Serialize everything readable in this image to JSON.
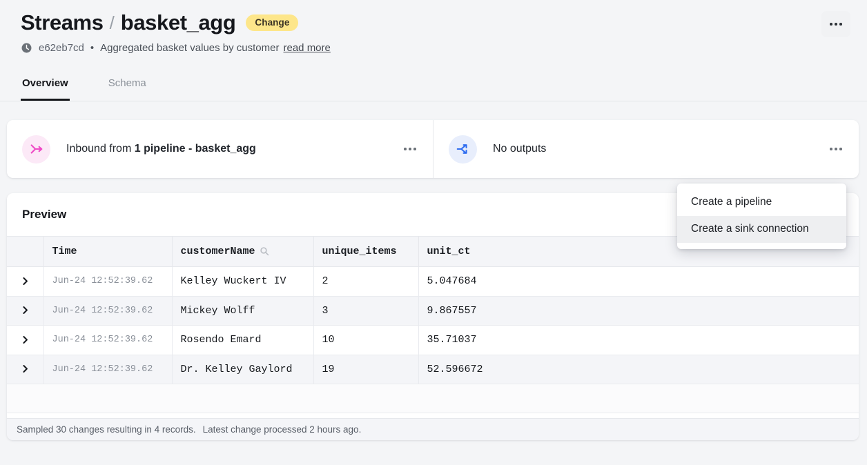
{
  "header": {
    "breadcrumb_parent": "Streams",
    "separator": "/",
    "breadcrumb_current": "basket_agg",
    "badge": "Change",
    "hash": "e62eb7cd",
    "bullet": "•",
    "description": "Aggregated basket values by customer",
    "read_more": "read more",
    "clock_icon": "clock-icon",
    "kebab_icon": "more-options-icon"
  },
  "tabs": [
    {
      "label": "Overview",
      "active": true
    },
    {
      "label": "Schema",
      "active": false
    }
  ],
  "cards": [
    {
      "icon": "merge-arrow-icon",
      "icon_color": "#ef4bc6",
      "icon_bg": "#fce9f7",
      "text_prefix": "Inbound from ",
      "text_strong": "1 pipeline - basket_agg",
      "kebab": "more-options-icon"
    },
    {
      "icon": "split-arrow-icon",
      "icon_color": "#2f6df0",
      "icon_bg": "#e8eefc",
      "text_prefix": "No outputs",
      "text_strong": "",
      "kebab": "more-options-icon"
    }
  ],
  "dropdown": {
    "items": [
      {
        "label": "Create a pipeline",
        "hovered": false
      },
      {
        "label": "Create a sink connection",
        "hovered": true
      }
    ]
  },
  "preview": {
    "title": "Preview",
    "columns": [
      {
        "key": "expand",
        "label": ""
      },
      {
        "key": "time",
        "label": "Time"
      },
      {
        "key": "customerName",
        "label": "customerName",
        "icon": "search-icon"
      },
      {
        "key": "unique_items",
        "label": "unique_items"
      },
      {
        "key": "unit_ct",
        "label": "unit_ct"
      }
    ],
    "rows": [
      {
        "time": "Jun-24 12:52:39.62",
        "customerName": "Kelley Wuckert IV",
        "unique_items": "2",
        "unit_ct": "5.047684"
      },
      {
        "time": "Jun-24 12:52:39.62",
        "customerName": "Mickey Wolff",
        "unique_items": "3",
        "unit_ct": "9.867557"
      },
      {
        "time": "Jun-24 12:52:39.62",
        "customerName": "Rosendo Emard",
        "unique_items": "10",
        "unit_ct": "35.71037"
      },
      {
        "time": "Jun-24 12:52:39.62",
        "customerName": "Dr. Kelley Gaylord",
        "unique_items": "19",
        "unit_ct": "52.596672"
      }
    ],
    "footer_sampled": "Sampled 30 changes resulting in 4 records.",
    "footer_latest": "Latest change processed 2 hours ago."
  },
  "colors": {
    "page_bg": "#f4f5f7",
    "badge_bg": "#fde68a",
    "accent_pink": "#ef4bc6",
    "accent_blue": "#2f6df0",
    "tab_active": "#15171b"
  }
}
